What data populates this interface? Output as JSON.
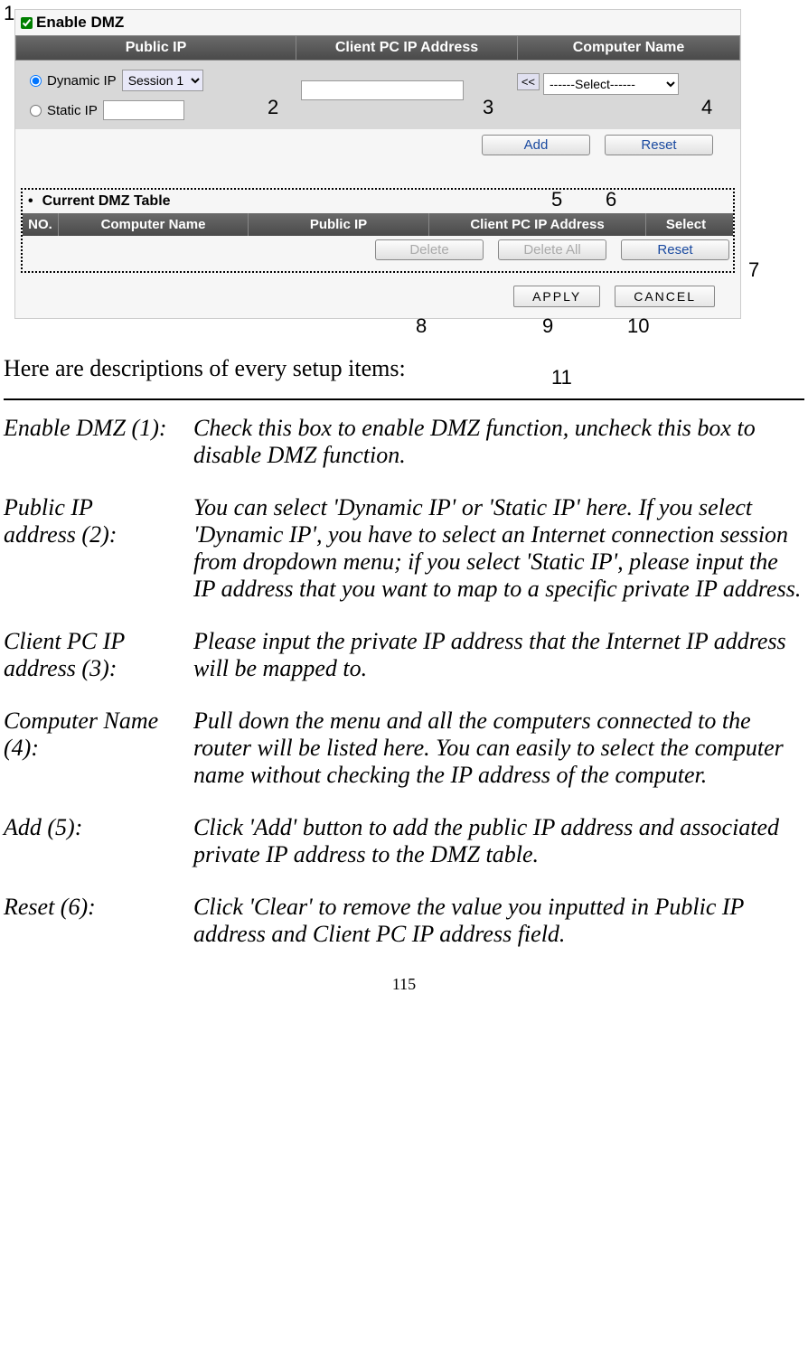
{
  "annotations": {
    "a1": "1",
    "a2": "2",
    "a3": "3",
    "a4": "4",
    "a5": "5",
    "a6": "6",
    "a7": "7",
    "a8": "8",
    "a9": "9",
    "a10": "10",
    "a11": "11"
  },
  "panel": {
    "enable_dmz_label": "Enable DMZ",
    "headers": {
      "public_ip": "Public IP",
      "client_pc_ip": "Client PC IP Address",
      "computer_name": "Computer Name"
    },
    "radios": {
      "dynamic": "Dynamic IP",
      "static": "Static IP"
    },
    "session_option": "Session 1",
    "arrow_btn": "<<",
    "computer_select": "------Select------",
    "buttons": {
      "add": "Add",
      "reset": "Reset"
    }
  },
  "dmz_table": {
    "title": "Current DMZ Table",
    "headers": {
      "no": "NO.",
      "computer_name": "Computer Name",
      "public_ip": "Public IP",
      "client_pc_ip": "Client PC IP Address",
      "select": "Select"
    },
    "buttons": {
      "delete": "Delete",
      "delete_all": "Delete All",
      "reset": "Reset"
    }
  },
  "final_buttons": {
    "apply": "APPLY",
    "cancel": "CANCEL"
  },
  "text": {
    "intro": "Here are descriptions of every setup items:",
    "items": {
      "enable_dmz": {
        "term": "Enable DMZ (1):",
        "def": "Check this box to enable DMZ function, uncheck this box to disable DMZ function."
      },
      "public_ip": {
        "term1": "Public IP",
        "term2": "address (2):",
        "def": "You can select 'Dynamic IP' or 'Static IP' here. If you select 'Dynamic IP', you have to select an Internet connection session from dropdown menu; if you select 'Static IP', please input the IP address that you want to map to a specific private IP address."
      },
      "client_pc": {
        "term1": "Client PC IP",
        "term2": "address (3):",
        "def": "Please input the private IP address that the Internet IP address will be mapped to."
      },
      "computer_name": {
        "term": "Computer Name (4):",
        "def": "Pull down the menu and all the computers connected to the router will be listed here. You can easily to select the computer name without checking the IP address of the computer."
      },
      "add": {
        "term": "Add (5):",
        "def": "Click 'Add' button to add the public IP address and associated private IP address to the DMZ table."
      },
      "reset": {
        "term": "Reset (6):",
        "def": "Click 'Clear' to remove the value you inputted in Public IP address and Client PC IP address field."
      }
    },
    "page_no": "115"
  }
}
